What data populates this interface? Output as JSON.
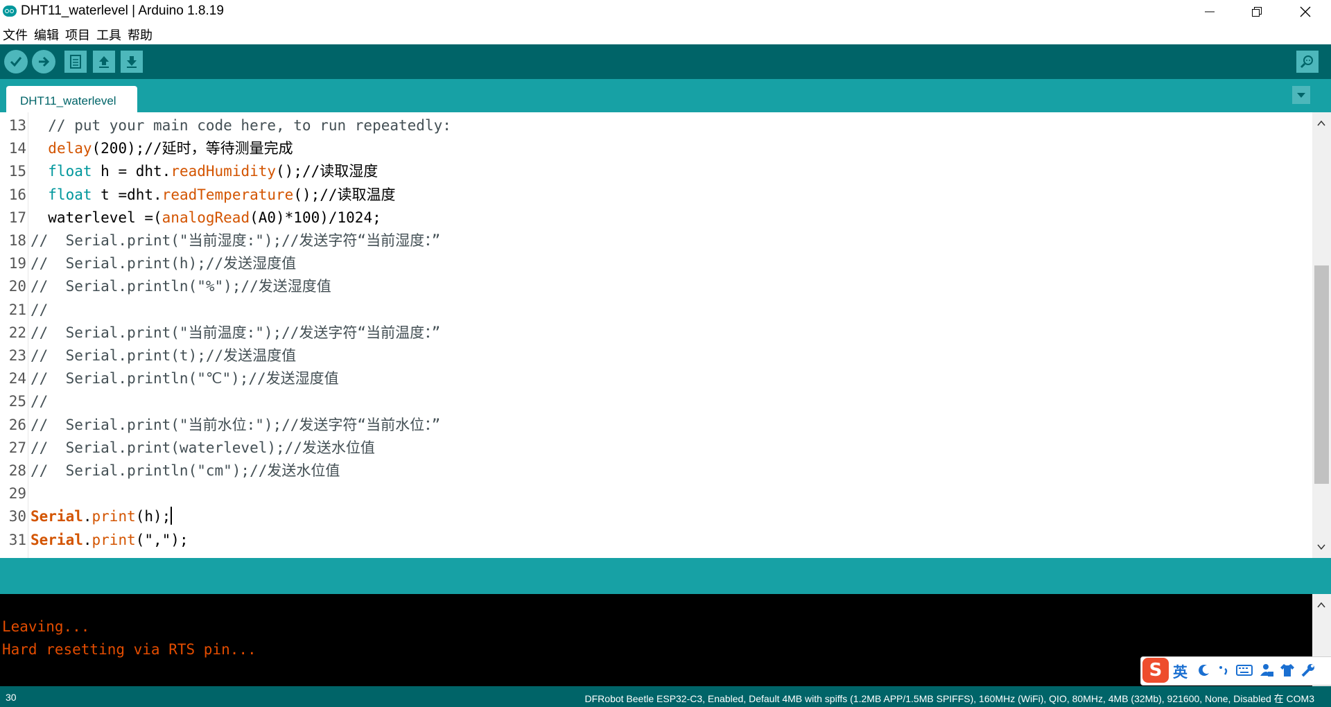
{
  "window": {
    "title": "DHT11_waterlevel | Arduino 1.8.19",
    "controls": [
      "minimize-icon",
      "restore-icon",
      "close-icon"
    ]
  },
  "menu": [
    "文件",
    "编辑",
    "项目",
    "工具",
    "帮助"
  ],
  "toolbar": {
    "buttons": [
      "verify-icon",
      "upload-icon",
      "new-icon",
      "open-icon",
      "save-icon"
    ],
    "right": "serial-monitor-icon"
  },
  "tab": {
    "label": "DHT11_waterlevel"
  },
  "editor": {
    "lines": [
      {
        "num": "13",
        "segs": [
          [
            "  // put your main code here, to run repeatedly:",
            "cm"
          ]
        ]
      },
      {
        "num": "14",
        "segs": [
          [
            "  ",
            ""
          ],
          [
            "delay",
            "fn"
          ],
          [
            "(200);//延时，等待测量完成",
            ""
          ]
        ]
      },
      {
        "num": "15",
        "segs": [
          [
            "  ",
            ""
          ],
          [
            "float",
            "kw"
          ],
          [
            " h = dht.",
            ""
          ],
          [
            "readHumidity",
            "fn"
          ],
          [
            "();//读取湿度",
            ""
          ]
        ]
      },
      {
        "num": "16",
        "segs": [
          [
            "  ",
            ""
          ],
          [
            "float",
            "kw"
          ],
          [
            " t =dht.",
            ""
          ],
          [
            "readTemperature",
            "fn"
          ],
          [
            "();//读取温度",
            ""
          ]
        ]
      },
      {
        "num": "17",
        "segs": [
          [
            "  waterlevel =(",
            ""
          ],
          [
            "analogRead",
            "fn"
          ],
          [
            "(A0)*100)/1024;",
            ""
          ]
        ]
      },
      {
        "num": "18",
        "segs": [
          [
            "//  Serial.print(\"当前湿度:\");//发送字符“当前湿度：”",
            "cm"
          ]
        ]
      },
      {
        "num": "19",
        "segs": [
          [
            "//  Serial.print(h);//发送湿度值",
            "cm"
          ]
        ]
      },
      {
        "num": "20",
        "segs": [
          [
            "//  Serial.println(\"%\");//发送湿度值",
            "cm"
          ]
        ]
      },
      {
        "num": "21",
        "segs": [
          [
            "//",
            "cm"
          ]
        ]
      },
      {
        "num": "22",
        "segs": [
          [
            "//  Serial.print(\"当前温度:\");//发送字符“当前温度：”",
            "cm"
          ]
        ]
      },
      {
        "num": "23",
        "segs": [
          [
            "//  Serial.print(t);//发送温度值",
            "cm"
          ]
        ]
      },
      {
        "num": "24",
        "segs": [
          [
            "//  Serial.println(\"℃\");//发送湿度值",
            "cm"
          ]
        ]
      },
      {
        "num": "25",
        "segs": [
          [
            "//",
            "cm"
          ]
        ]
      },
      {
        "num": "26",
        "segs": [
          [
            "//  Serial.print(\"当前水位:\");//发送字符“当前水位：”",
            "cm"
          ]
        ]
      },
      {
        "num": "27",
        "segs": [
          [
            "//  Serial.print(waterlevel);//发送水位值",
            "cm"
          ]
        ]
      },
      {
        "num": "28",
        "segs": [
          [
            "//  Serial.println(\"cm\");//发送水位值",
            "cm"
          ]
        ]
      },
      {
        "num": "29",
        "segs": []
      },
      {
        "num": "30",
        "segs": [
          [
            "Serial",
            "obj"
          ],
          [
            ".",
            ""
          ],
          [
            "print",
            "fn"
          ],
          [
            "(h);",
            ""
          ]
        ],
        "cursor": true
      },
      {
        "num": "31",
        "segs": [
          [
            "Serial",
            "obj"
          ],
          [
            ".",
            ""
          ],
          [
            "print",
            "fn"
          ],
          [
            "(\",\");",
            ""
          ]
        ]
      }
    ]
  },
  "console": {
    "lines": [
      "Leaving...",
      "Hard resetting via RTS pin..."
    ]
  },
  "status": {
    "line": "30",
    "board": "DFRobot Beetle ESP32-C3, Enabled, Default 4MB with spiffs (1.2MB APP/1.5MB SPIFFS), 160MHz (WiFi), QIO, 80MHz, 4MB (32Mb), 921600, None, Disabled 在 COM3"
  },
  "ime": {
    "logo": "S",
    "lang": "英",
    "icons": [
      "moon-icon",
      "punctuation-icon",
      "keyboard-icon",
      "user-icon",
      "shirt-icon",
      "wrench-icon"
    ]
  },
  "colors": {
    "toolbar": "#006468",
    "tabstrip": "#17a1a5",
    "keyword": "#00979c",
    "function": "#d35400",
    "console_text": "#e34c00"
  }
}
